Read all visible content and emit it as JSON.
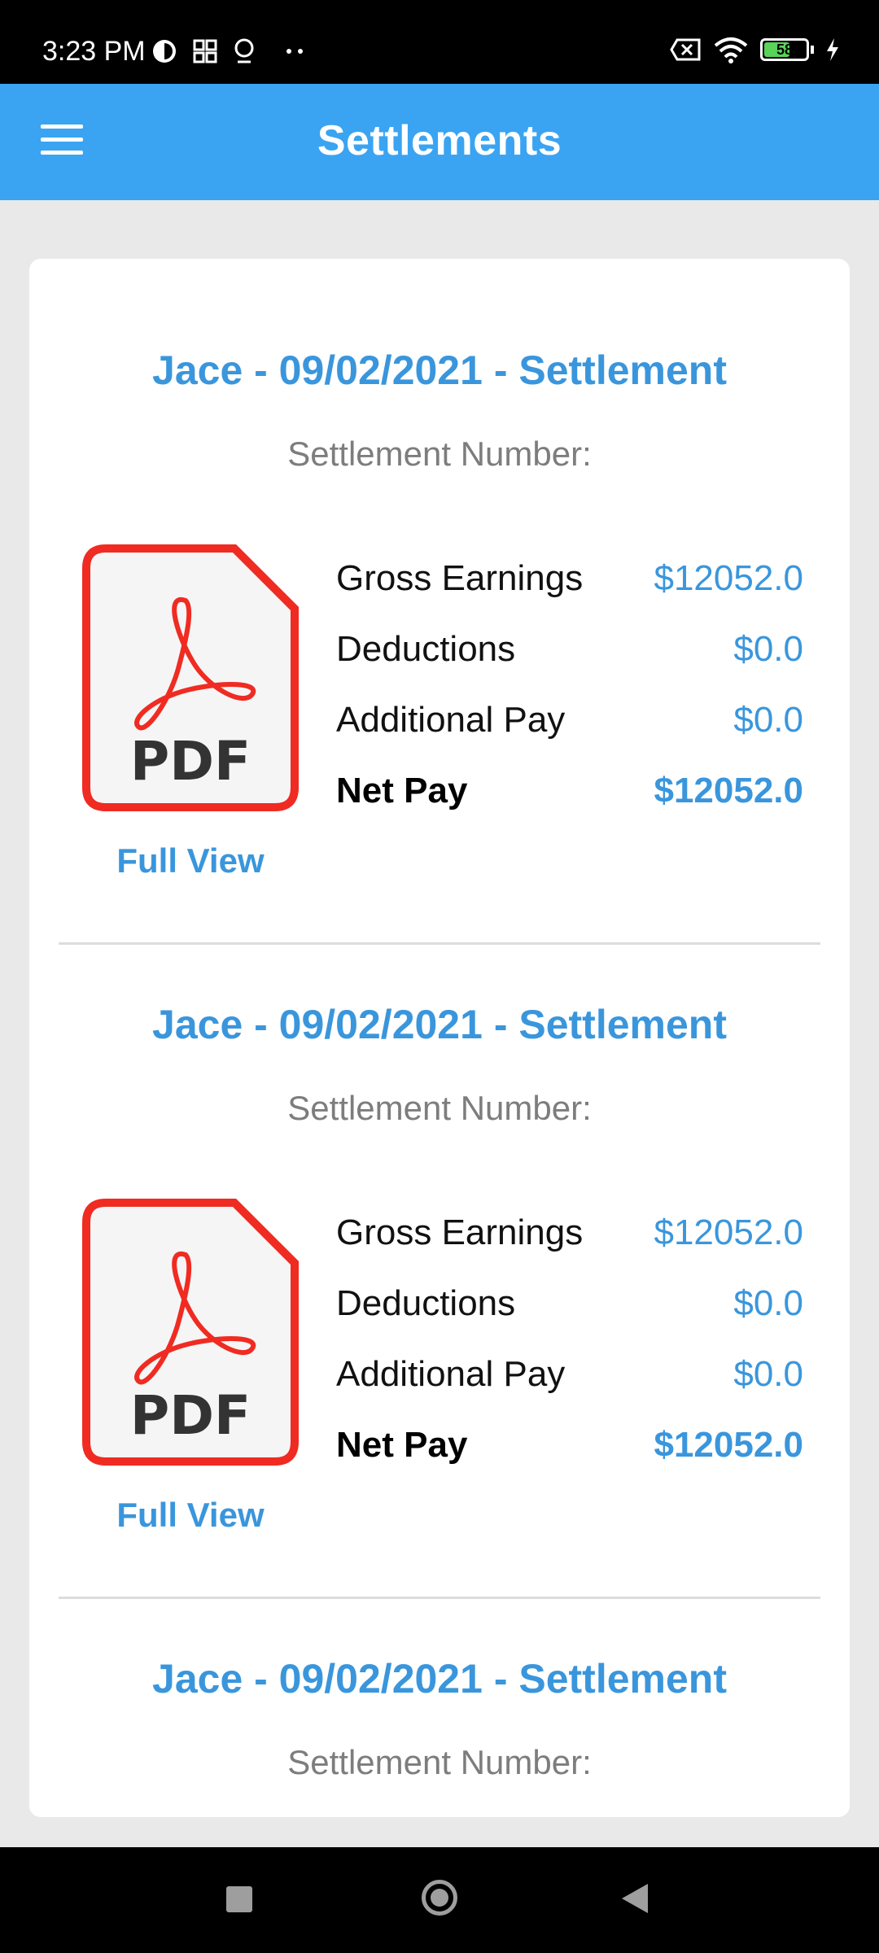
{
  "status_bar": {
    "time": "3:23 PM",
    "battery_level": "58",
    "left_icons": [
      "app-notification-icon",
      "grid-apps-icon",
      "location-icon",
      "more-dots-icon"
    ],
    "right_icons": [
      "sim-off-icon",
      "wifi-icon",
      "battery-icon",
      "charging-icon"
    ]
  },
  "app_bar": {
    "title": "Settlements",
    "menu_icon": "hamburger-menu-icon",
    "color": "#3aa4f2"
  },
  "settlements": [
    {
      "title": "Jace - 09/02/2021 - Settlement",
      "settlement_number_label": "Settlement Number:",
      "icon": "pdf-file-icon",
      "icon_text": "PDF",
      "full_view_label": "Full View",
      "rows": [
        {
          "label": "Gross Earnings",
          "value": "$12052.0"
        },
        {
          "label": "Deductions",
          "value": "$0.0"
        },
        {
          "label": "Additional Pay",
          "value": "$0.0"
        },
        {
          "label": "Net Pay",
          "value": "$12052.0"
        }
      ]
    },
    {
      "title": "Jace - 09/02/2021 - Settlement",
      "settlement_number_label": "Settlement Number:",
      "icon": "pdf-file-icon",
      "icon_text": "PDF",
      "full_view_label": "Full View",
      "rows": [
        {
          "label": "Gross Earnings",
          "value": "$12052.0"
        },
        {
          "label": "Deductions",
          "value": "$0.0"
        },
        {
          "label": "Additional Pay",
          "value": "$0.0"
        },
        {
          "label": "Net Pay",
          "value": "$12052.0"
        }
      ]
    },
    {
      "title": "Jace - 09/02/2021 - Settlement",
      "settlement_number_label": "Settlement Number:"
    }
  ],
  "colors": {
    "accent_text": "#3a96dc",
    "pdf_red": "#f02b22",
    "background": "#e9e9e9"
  },
  "nav_bar": {
    "icons": [
      "recents-square-icon",
      "home-circle-icon",
      "back-triangle-icon"
    ]
  }
}
